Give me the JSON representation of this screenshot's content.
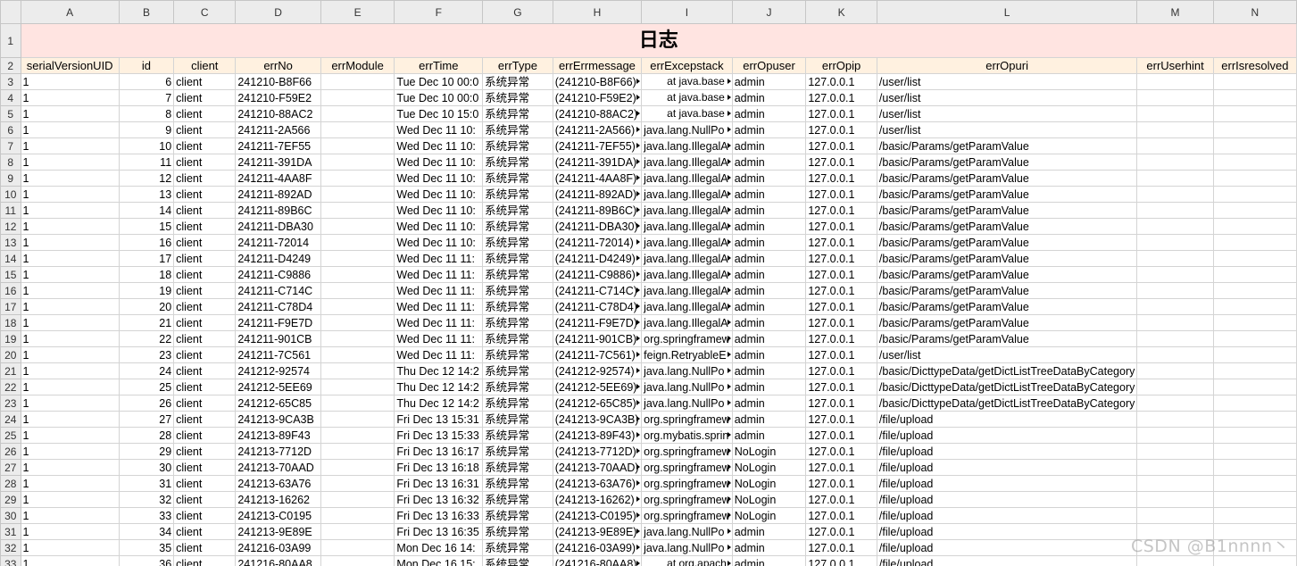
{
  "title": "日志",
  "columns": [
    "A",
    "B",
    "C",
    "D",
    "E",
    "F",
    "G",
    "H",
    "I",
    "J",
    "K",
    "L",
    "M",
    "N"
  ],
  "headers": [
    "serialVersionUID",
    "id",
    "client",
    "errNo",
    "errModule",
    "errTime",
    "errType",
    "errErrmessage",
    "errExcepstack",
    "errOpuser",
    "errOpip",
    "errOpuri",
    "errUserhint",
    "errIsresolved"
  ],
  "rows": [
    {
      "r": "3",
      "uid": "1",
      "id": "6",
      "client": "client",
      "errNo": "241210-B8F66",
      "errModule": "",
      "errTime": "Tue Dec 10 00:0",
      "errType": "系统异常",
      "msg": "(241210-B8F66)",
      "stack": "at java.base",
      "user": "admin",
      "ip": "127.0.0.1",
      "uri": "/user/list",
      "hint": "",
      "resolved": ""
    },
    {
      "r": "4",
      "uid": "1",
      "id": "7",
      "client": "client",
      "errNo": "241210-F59E2",
      "errModule": "",
      "errTime": "Tue Dec 10 00:0",
      "errType": "系统异常",
      "msg": "(241210-F59E2)",
      "stack": "at java.base",
      "user": "admin",
      "ip": "127.0.0.1",
      "uri": "/user/list",
      "hint": "",
      "resolved": ""
    },
    {
      "r": "5",
      "uid": "1",
      "id": "8",
      "client": "client",
      "errNo": "241210-88AC2",
      "errModule": "",
      "errTime": "Tue Dec 10 15:0",
      "errType": "系统异常",
      "msg": "(241210-88AC2)",
      "stack": "at java.base",
      "user": "admin",
      "ip": "127.0.0.1",
      "uri": "/user/list",
      "hint": "",
      "resolved": ""
    },
    {
      "r": "6",
      "uid": "1",
      "id": "9",
      "client": "client",
      "errNo": "241211-2A566",
      "errModule": "",
      "errTime": "Wed Dec 11 10:",
      "errType": "系统异常",
      "msg": "(241211-2A566)",
      "stack": "java.lang.NullPo",
      "user": "admin",
      "ip": "127.0.0.1",
      "uri": "/user/list",
      "hint": "",
      "resolved": ""
    },
    {
      "r": "7",
      "uid": "1",
      "id": "10",
      "client": "client",
      "errNo": "241211-7EF55",
      "errModule": "",
      "errTime": "Wed Dec 11 10:",
      "errType": "系统异常",
      "msg": "(241211-7EF55)",
      "stack": "java.lang.IllegalA",
      "user": "admin",
      "ip": "127.0.0.1",
      "uri": "/basic/Params/getParamValue",
      "hint": "",
      "resolved": ""
    },
    {
      "r": "8",
      "uid": "1",
      "id": "11",
      "client": "client",
      "errNo": "241211-391DA",
      "errModule": "",
      "errTime": "Wed Dec 11 10:",
      "errType": "系统异常",
      "msg": "(241211-391DA)",
      "stack": "java.lang.IllegalA",
      "user": "admin",
      "ip": "127.0.0.1",
      "uri": "/basic/Params/getParamValue",
      "hint": "",
      "resolved": ""
    },
    {
      "r": "9",
      "uid": "1",
      "id": "12",
      "client": "client",
      "errNo": "241211-4AA8F",
      "errModule": "",
      "errTime": "Wed Dec 11 10:",
      "errType": "系统异常",
      "msg": "(241211-4AA8F)",
      "stack": "java.lang.IllegalA",
      "user": "admin",
      "ip": "127.0.0.1",
      "uri": "/basic/Params/getParamValue",
      "hint": "",
      "resolved": ""
    },
    {
      "r": "10",
      "uid": "1",
      "id": "13",
      "client": "client",
      "errNo": "241211-892AD",
      "errModule": "",
      "errTime": "Wed Dec 11 10:",
      "errType": "系统异常",
      "msg": "(241211-892AD)",
      "stack": "java.lang.IllegalA",
      "user": "admin",
      "ip": "127.0.0.1",
      "uri": "/basic/Params/getParamValue",
      "hint": "",
      "resolved": ""
    },
    {
      "r": "11",
      "uid": "1",
      "id": "14",
      "client": "client",
      "errNo": "241211-89B6C",
      "errModule": "",
      "errTime": "Wed Dec 11 10:",
      "errType": "系统异常",
      "msg": "(241211-89B6C)",
      "stack": "java.lang.IllegalA",
      "user": "admin",
      "ip": "127.0.0.1",
      "uri": "/basic/Params/getParamValue",
      "hint": "",
      "resolved": ""
    },
    {
      "r": "12",
      "uid": "1",
      "id": "15",
      "client": "client",
      "errNo": "241211-DBA30",
      "errModule": "",
      "errTime": "Wed Dec 11 10:",
      "errType": "系统异常",
      "msg": "(241211-DBA30)",
      "stack": "java.lang.IllegalA",
      "user": "admin",
      "ip": "127.0.0.1",
      "uri": "/basic/Params/getParamValue",
      "hint": "",
      "resolved": ""
    },
    {
      "r": "13",
      "uid": "1",
      "id": "16",
      "client": "client",
      "errNo": "241211-72014",
      "errModule": "",
      "errTime": "Wed Dec 11 10:",
      "errType": "系统异常",
      "msg": "(241211-72014)",
      "stack": "java.lang.IllegalA",
      "user": "admin",
      "ip": "127.0.0.1",
      "uri": "/basic/Params/getParamValue",
      "hint": "",
      "resolved": ""
    },
    {
      "r": "14",
      "uid": "1",
      "id": "17",
      "client": "client",
      "errNo": "241211-D4249",
      "errModule": "",
      "errTime": "Wed Dec 11 11:",
      "errType": "系统异常",
      "msg": "(241211-D4249)",
      "stack": "java.lang.IllegalA",
      "user": "admin",
      "ip": "127.0.0.1",
      "uri": "/basic/Params/getParamValue",
      "hint": "",
      "resolved": ""
    },
    {
      "r": "15",
      "uid": "1",
      "id": "18",
      "client": "client",
      "errNo": "241211-C9886",
      "errModule": "",
      "errTime": "Wed Dec 11 11:",
      "errType": "系统异常",
      "msg": "(241211-C9886)",
      "stack": "java.lang.IllegalA",
      "user": "admin",
      "ip": "127.0.0.1",
      "uri": "/basic/Params/getParamValue",
      "hint": "",
      "resolved": ""
    },
    {
      "r": "16",
      "uid": "1",
      "id": "19",
      "client": "client",
      "errNo": "241211-C714C",
      "errModule": "",
      "errTime": "Wed Dec 11 11:",
      "errType": "系统异常",
      "msg": "(241211-C714C)",
      "stack": "java.lang.IllegalA",
      "user": "admin",
      "ip": "127.0.0.1",
      "uri": "/basic/Params/getParamValue",
      "hint": "",
      "resolved": ""
    },
    {
      "r": "17",
      "uid": "1",
      "id": "20",
      "client": "client",
      "errNo": "241211-C78D4",
      "errModule": "",
      "errTime": "Wed Dec 11 11:",
      "errType": "系统异常",
      "msg": "(241211-C78D4)",
      "stack": "java.lang.IllegalA",
      "user": "admin",
      "ip": "127.0.0.1",
      "uri": "/basic/Params/getParamValue",
      "hint": "",
      "resolved": ""
    },
    {
      "r": "18",
      "uid": "1",
      "id": "21",
      "client": "client",
      "errNo": "241211-F9E7D",
      "errModule": "",
      "errTime": "Wed Dec 11 11:",
      "errType": "系统异常",
      "msg": "(241211-F9E7D)",
      "stack": "java.lang.IllegalA",
      "user": "admin",
      "ip": "127.0.0.1",
      "uri": "/basic/Params/getParamValue",
      "hint": "",
      "resolved": ""
    },
    {
      "r": "19",
      "uid": "1",
      "id": "22",
      "client": "client",
      "errNo": "241211-901CB",
      "errModule": "",
      "errTime": "Wed Dec 11 11:",
      "errType": "系统异常",
      "msg": "(241211-901CB)",
      "stack": "org.springframew",
      "user": "admin",
      "ip": "127.0.0.1",
      "uri": "/basic/Params/getParamValue",
      "hint": "",
      "resolved": ""
    },
    {
      "r": "20",
      "uid": "1",
      "id": "23",
      "client": "client",
      "errNo": "241211-7C561",
      "errModule": "",
      "errTime": "Wed Dec 11 11:",
      "errType": "系统异常",
      "msg": "(241211-7C561)",
      "stack": "feign.RetryableE",
      "user": "admin",
      "ip": "127.0.0.1",
      "uri": "/user/list",
      "hint": "",
      "resolved": ""
    },
    {
      "r": "21",
      "uid": "1",
      "id": "24",
      "client": "client",
      "errNo": "241212-92574",
      "errModule": "",
      "errTime": "Thu Dec 12 14:2",
      "errType": "系统异常",
      "msg": "(241212-92574)",
      "stack": "java.lang.NullPo",
      "user": "admin",
      "ip": "127.0.0.1",
      "uri": "/basic/DicttypeData/getDictListTreeDataByCategory",
      "hint": "",
      "resolved": ""
    },
    {
      "r": "22",
      "uid": "1",
      "id": "25",
      "client": "client",
      "errNo": "241212-5EE69",
      "errModule": "",
      "errTime": "Thu Dec 12 14:2",
      "errType": "系统异常",
      "msg": "(241212-5EE69)",
      "stack": "java.lang.NullPo",
      "user": "admin",
      "ip": "127.0.0.1",
      "uri": "/basic/DicttypeData/getDictListTreeDataByCategory",
      "hint": "",
      "resolved": ""
    },
    {
      "r": "23",
      "uid": "1",
      "id": "26",
      "client": "client",
      "errNo": "241212-65C85",
      "errModule": "",
      "errTime": "Thu Dec 12 14:2",
      "errType": "系统异常",
      "msg": "(241212-65C85)",
      "stack": "java.lang.NullPo",
      "user": "admin",
      "ip": "127.0.0.1",
      "uri": "/basic/DicttypeData/getDictListTreeDataByCategory",
      "hint": "",
      "resolved": ""
    },
    {
      "r": "24",
      "uid": "1",
      "id": "27",
      "client": "client",
      "errNo": "241213-9CA3B",
      "errModule": "",
      "errTime": "Fri Dec 13 15:31",
      "errType": "系统异常",
      "msg": "(241213-9CA3B)",
      "stack": "org.springframew",
      "user": "admin",
      "ip": "127.0.0.1",
      "uri": "/file/upload",
      "hint": "",
      "resolved": ""
    },
    {
      "r": "25",
      "uid": "1",
      "id": "28",
      "client": "client",
      "errNo": "241213-89F43",
      "errModule": "",
      "errTime": "Fri Dec 13 15:33",
      "errType": "系统异常",
      "msg": "(241213-89F43)",
      "stack": "org.mybatis.sprin",
      "user": "admin",
      "ip": "127.0.0.1",
      "uri": "/file/upload",
      "hint": "",
      "resolved": ""
    },
    {
      "r": "26",
      "uid": "1",
      "id": "29",
      "client": "client",
      "errNo": "241213-7712D",
      "errModule": "",
      "errTime": "Fri Dec 13 16:17",
      "errType": "系统异常",
      "msg": "(241213-7712D)",
      "stack": "org.springframew",
      "user": "NoLogin",
      "ip": "127.0.0.1",
      "uri": "/file/upload",
      "hint": "",
      "resolved": ""
    },
    {
      "r": "27",
      "uid": "1",
      "id": "30",
      "client": "client",
      "errNo": "241213-70AAD",
      "errModule": "",
      "errTime": "Fri Dec 13 16:18",
      "errType": "系统异常",
      "msg": "(241213-70AAD)",
      "stack": "org.springframew",
      "user": "NoLogin",
      "ip": "127.0.0.1",
      "uri": "/file/upload",
      "hint": "",
      "resolved": ""
    },
    {
      "r": "28",
      "uid": "1",
      "id": "31",
      "client": "client",
      "errNo": "241213-63A76",
      "errModule": "",
      "errTime": "Fri Dec 13 16:31",
      "errType": "系统异常",
      "msg": "(241213-63A76)",
      "stack": "org.springframew",
      "user": "NoLogin",
      "ip": "127.0.0.1",
      "uri": "/file/upload",
      "hint": "",
      "resolved": ""
    },
    {
      "r": "29",
      "uid": "1",
      "id": "32",
      "client": "client",
      "errNo": "241213-16262",
      "errModule": "",
      "errTime": "Fri Dec 13 16:32",
      "errType": "系统异常",
      "msg": "(241213-16262)",
      "stack": "org.springframew",
      "user": "NoLogin",
      "ip": "127.0.0.1",
      "uri": "/file/upload",
      "hint": "",
      "resolved": ""
    },
    {
      "r": "30",
      "uid": "1",
      "id": "33",
      "client": "client",
      "errNo": "241213-C0195",
      "errModule": "",
      "errTime": "Fri Dec 13 16:33",
      "errType": "系统异常",
      "msg": "(241213-C0195)",
      "stack": "org.springframew",
      "user": "NoLogin",
      "ip": "127.0.0.1",
      "uri": "/file/upload",
      "hint": "",
      "resolved": ""
    },
    {
      "r": "31",
      "uid": "1",
      "id": "34",
      "client": "client",
      "errNo": "241213-9E89E",
      "errModule": "",
      "errTime": "Fri Dec 13 16:35",
      "errType": "系统异常",
      "msg": "(241213-9E89E)",
      "stack": "java.lang.NullPo",
      "user": "admin",
      "ip": "127.0.0.1",
      "uri": "/file/upload",
      "hint": "",
      "resolved": ""
    },
    {
      "r": "32",
      "uid": "1",
      "id": "35",
      "client": "client",
      "errNo": "241216-03A99",
      "errModule": "",
      "errTime": "Mon Dec 16 14:",
      "errType": "系统异常",
      "msg": "(241216-03A99)",
      "stack": "java.lang.NullPo",
      "user": "admin",
      "ip": "127.0.0.1",
      "uri": "/file/upload",
      "hint": "",
      "resolved": ""
    },
    {
      "r": "33",
      "uid": "1",
      "id": "36",
      "client": "client",
      "errNo": "241216-80AA8",
      "errModule": "",
      "errTime": "Mon Dec 16 15:",
      "errType": "系统异常",
      "msg": "(241216-80AA8)",
      "stack": "at org.apach",
      "user": "admin",
      "ip": "127.0.0.1",
      "uri": "/file/upload",
      "hint": "",
      "resolved": ""
    }
  ],
  "watermark": "CSDN @B1nnnn丶"
}
